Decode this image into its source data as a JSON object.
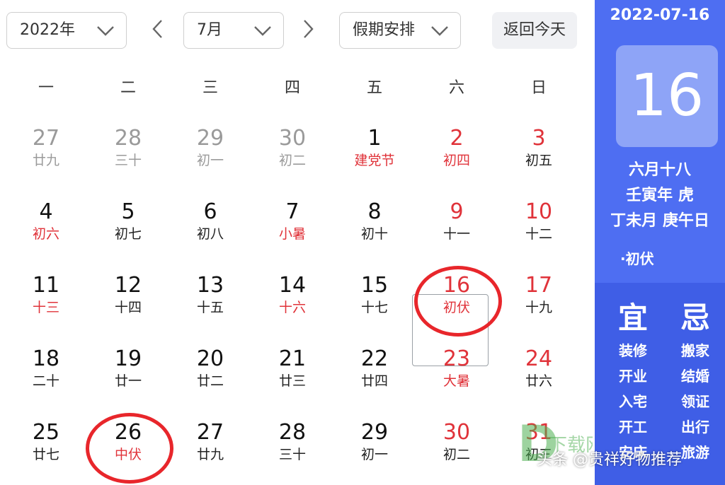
{
  "toolbar": {
    "year_value": "2022年",
    "month_value": "7月",
    "holiday_value": "假期安排",
    "today_label": "返回今天"
  },
  "weekdays": [
    "一",
    "二",
    "三",
    "四",
    "五",
    "六",
    "日"
  ],
  "weeks": [
    [
      {
        "day": "27",
        "lunar": "廿九",
        "other": true
      },
      {
        "day": "28",
        "lunar": "三十",
        "other": true
      },
      {
        "day": "29",
        "lunar": "初一",
        "other": true
      },
      {
        "day": "30",
        "lunar": "初二",
        "other": true
      },
      {
        "day": "1",
        "lunar": "建党节",
        "festival": true
      },
      {
        "day": "2",
        "lunar": "初四",
        "weekend": true,
        "festival": true
      },
      {
        "day": "3",
        "lunar": "初五",
        "weekend": true
      }
    ],
    [
      {
        "day": "4",
        "lunar": "初六",
        "festival": true
      },
      {
        "day": "5",
        "lunar": "初七"
      },
      {
        "day": "6",
        "lunar": "初八"
      },
      {
        "day": "7",
        "lunar": "小暑",
        "festival": true
      },
      {
        "day": "8",
        "lunar": "初十"
      },
      {
        "day": "9",
        "lunar": "十一",
        "weekend": true
      },
      {
        "day": "10",
        "lunar": "十二",
        "weekend": true
      }
    ],
    [
      {
        "day": "11",
        "lunar": "十三",
        "festival": true
      },
      {
        "day": "12",
        "lunar": "十四"
      },
      {
        "day": "13",
        "lunar": "十五"
      },
      {
        "day": "14",
        "lunar": "十六",
        "festival": true
      },
      {
        "day": "15",
        "lunar": "十七"
      },
      {
        "day": "16",
        "lunar": "初伏",
        "weekend": true,
        "festival": true,
        "selected": true,
        "circled": true
      },
      {
        "day": "17",
        "lunar": "十九",
        "weekend": true
      }
    ],
    [
      {
        "day": "18",
        "lunar": "二十"
      },
      {
        "day": "19",
        "lunar": "廿一"
      },
      {
        "day": "20",
        "lunar": "廿二"
      },
      {
        "day": "21",
        "lunar": "廿三"
      },
      {
        "day": "22",
        "lunar": "廿四"
      },
      {
        "day": "23",
        "lunar": "大暑",
        "weekend": true,
        "festival": true
      },
      {
        "day": "24",
        "lunar": "廿六",
        "weekend": true
      }
    ],
    [
      {
        "day": "25",
        "lunar": "廿七"
      },
      {
        "day": "26",
        "lunar": "中伏",
        "festival": true,
        "circled": true
      },
      {
        "day": "27",
        "lunar": "廿九"
      },
      {
        "day": "28",
        "lunar": "三十"
      },
      {
        "day": "29",
        "lunar": "初一"
      },
      {
        "day": "30",
        "lunar": "初二",
        "weekend": true
      },
      {
        "day": "31",
        "lunar": "初三",
        "weekend": true
      }
    ]
  ],
  "side": {
    "date": "2022-07-16",
    "big_day": "16",
    "lunar_date": "六月十八",
    "year_ganzhi": "壬寅年 虎",
    "month_day_ganzhi": "丁未月 庚午日",
    "solar_term": "初伏",
    "good_title": "宜",
    "good_items": [
      "装修",
      "开业",
      "入宅",
      "开工",
      "安床"
    ],
    "bad_title": "忌",
    "bad_items": [
      "搬家",
      "结婚",
      "领证",
      "出行",
      "旅游"
    ]
  },
  "watermark": {
    "logo_text": "下载网",
    "caption": "头条 @贵祥好物推荐"
  },
  "colors": {
    "accent": "#4e6ef2",
    "holiday_red": "#e0333a",
    "annotation_red": "#e8262b"
  }
}
